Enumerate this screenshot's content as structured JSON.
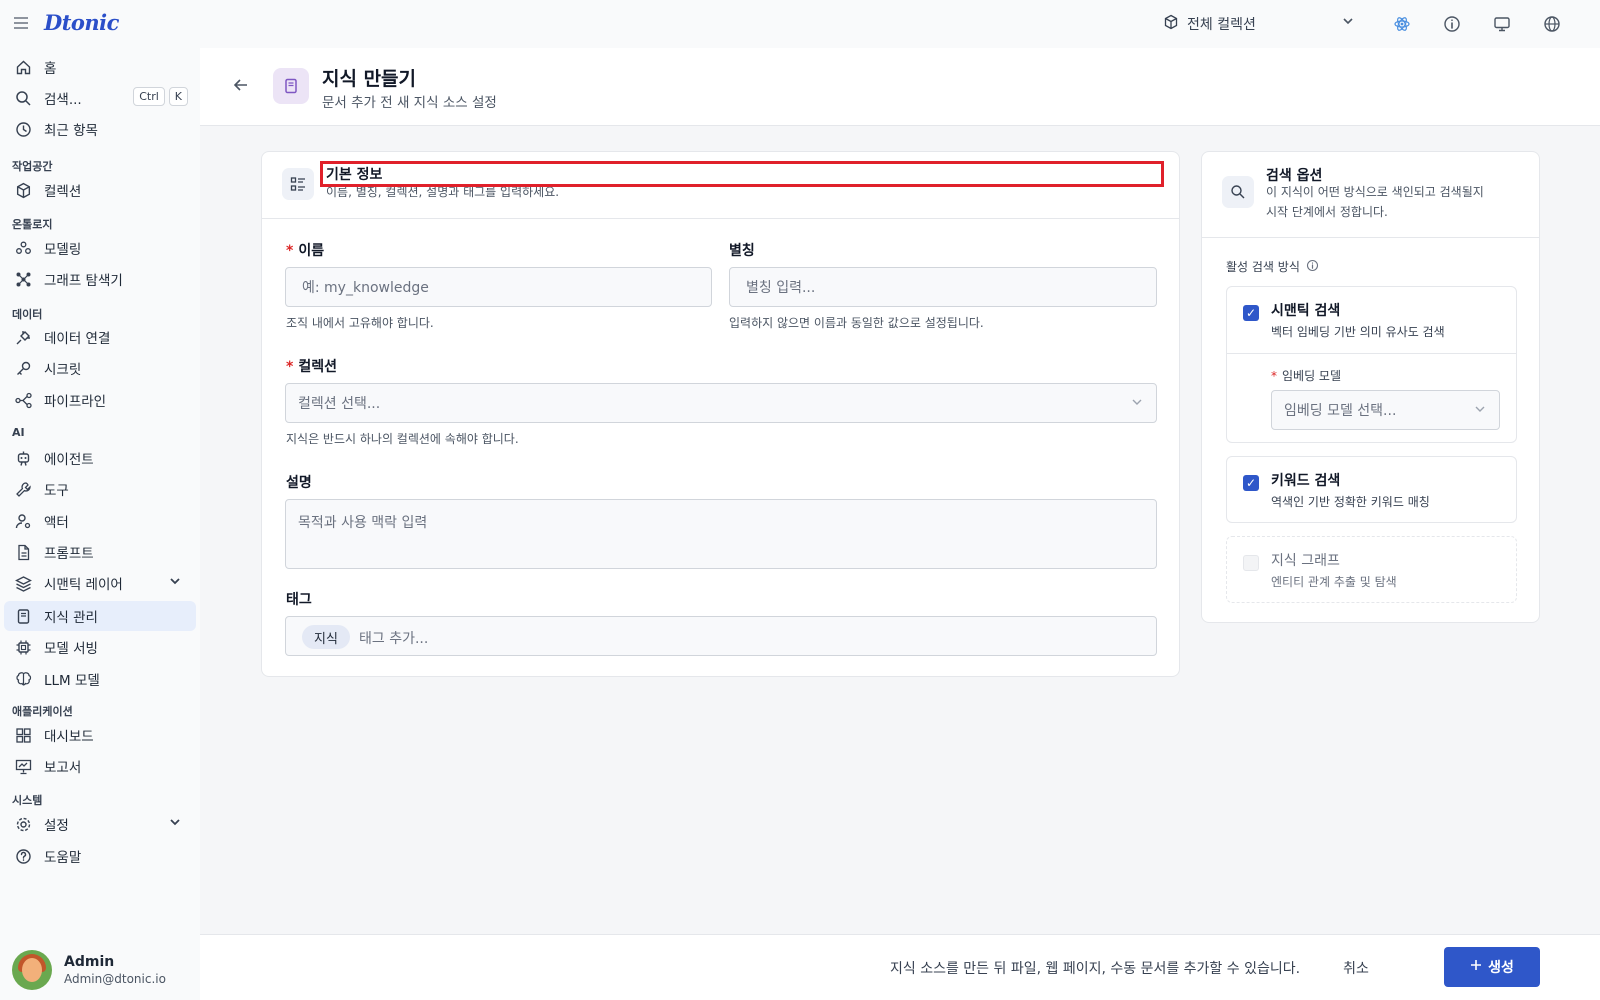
{
  "app": {
    "logo": "Dtonic",
    "collection_selector": "전체 컬렉션"
  },
  "sidebar": {
    "search_shortcut": [
      "Ctrl",
      "K"
    ],
    "top_items": [
      {
        "label": "홈",
        "icon": "home-icon"
      },
      {
        "label": "검색...",
        "icon": "search-icon"
      },
      {
        "label": "최근 항목",
        "icon": "clock-icon"
      }
    ],
    "sections": {
      "workspace": "작업공간",
      "ontology": "온톨로지",
      "data": "데이터",
      "ai": "AI",
      "applications": "애플리케이션",
      "system": "시스템"
    },
    "items": {
      "collection": "컬렉션",
      "modeling": "모델링",
      "graph_explorer": "그래프 탐색기",
      "data_connection": "데이터 연결",
      "secrets": "시크릿",
      "pipeline": "파이프라인",
      "agent": "에이전트",
      "tools": "도구",
      "actor": "액터",
      "prompt": "프롬프트",
      "semantic_layer": "시맨틱 레이어",
      "knowledge": "지식 관리",
      "model_serving": "모델 서빙",
      "llm_models": "LLM 모델",
      "dashboard": "대시보드",
      "report": "보고서",
      "settings": "설정",
      "help": "도움말"
    },
    "active_item": "지식 관리",
    "user": {
      "name": "Admin",
      "email": "Admin@dtonic.io"
    }
  },
  "header": {
    "title": "지식 만들기",
    "subtitle": "문서 추가 전 새 지식 소스 설정"
  },
  "basic_info": {
    "title": "기본 정보",
    "description": "이름, 별칭, 컬렉션, 설명과 태그를 입력하세요.",
    "name": {
      "label": "이름",
      "placeholder": "예: my_knowledge",
      "hint": "조직 내에서 고유해야 합니다."
    },
    "alias": {
      "label": "별칭",
      "placeholder": "별칭 입력...",
      "hint": "입력하지 않으면 이름과 동일한 값으로 설정됩니다."
    },
    "collection": {
      "label": "컬렉션",
      "placeholder": "컬렉션 선택...",
      "hint": "지식은 반드시 하나의 컬렉션에 속해야 합니다."
    },
    "description_field": {
      "label": "설명",
      "placeholder": "목적과 사용 맥락 입력"
    },
    "tags": {
      "label": "태그",
      "chips": [
        "지식"
      ],
      "placeholder": "태그 추가..."
    }
  },
  "search_options": {
    "title": "검색 옵션",
    "description_line1": "이 지식이 어떤 방식으로 색인되고 검색될지",
    "description_line2": "시작 단계에서 정합니다.",
    "active_methods_label": "활성 검색 방식",
    "semantic": {
      "title": "시맨틱 검색",
      "desc": "벡터 임베딩 기반 의미 유사도 검색",
      "checked": true
    },
    "embedding_model": {
      "label": "임베딩 모델",
      "placeholder": "임베딩 모델 선택..."
    },
    "keyword": {
      "title": "키워드 검색",
      "desc": "역색인 기반 정확한 키워드 매칭",
      "checked": true
    },
    "graph": {
      "title": "지식 그래프",
      "desc": "엔티티 관계 추출 및 탐색",
      "checked": false
    }
  },
  "footer": {
    "note": "지식 소스를 만든 뒤 파일, 웹 페이지, 수동 문서를 추가할 수 있습니다.",
    "cancel": "취소",
    "create": "생성"
  },
  "colors": {
    "accent": "#2f57c9",
    "highlight": "#e0202a",
    "active_nav": "#e7eefb"
  }
}
